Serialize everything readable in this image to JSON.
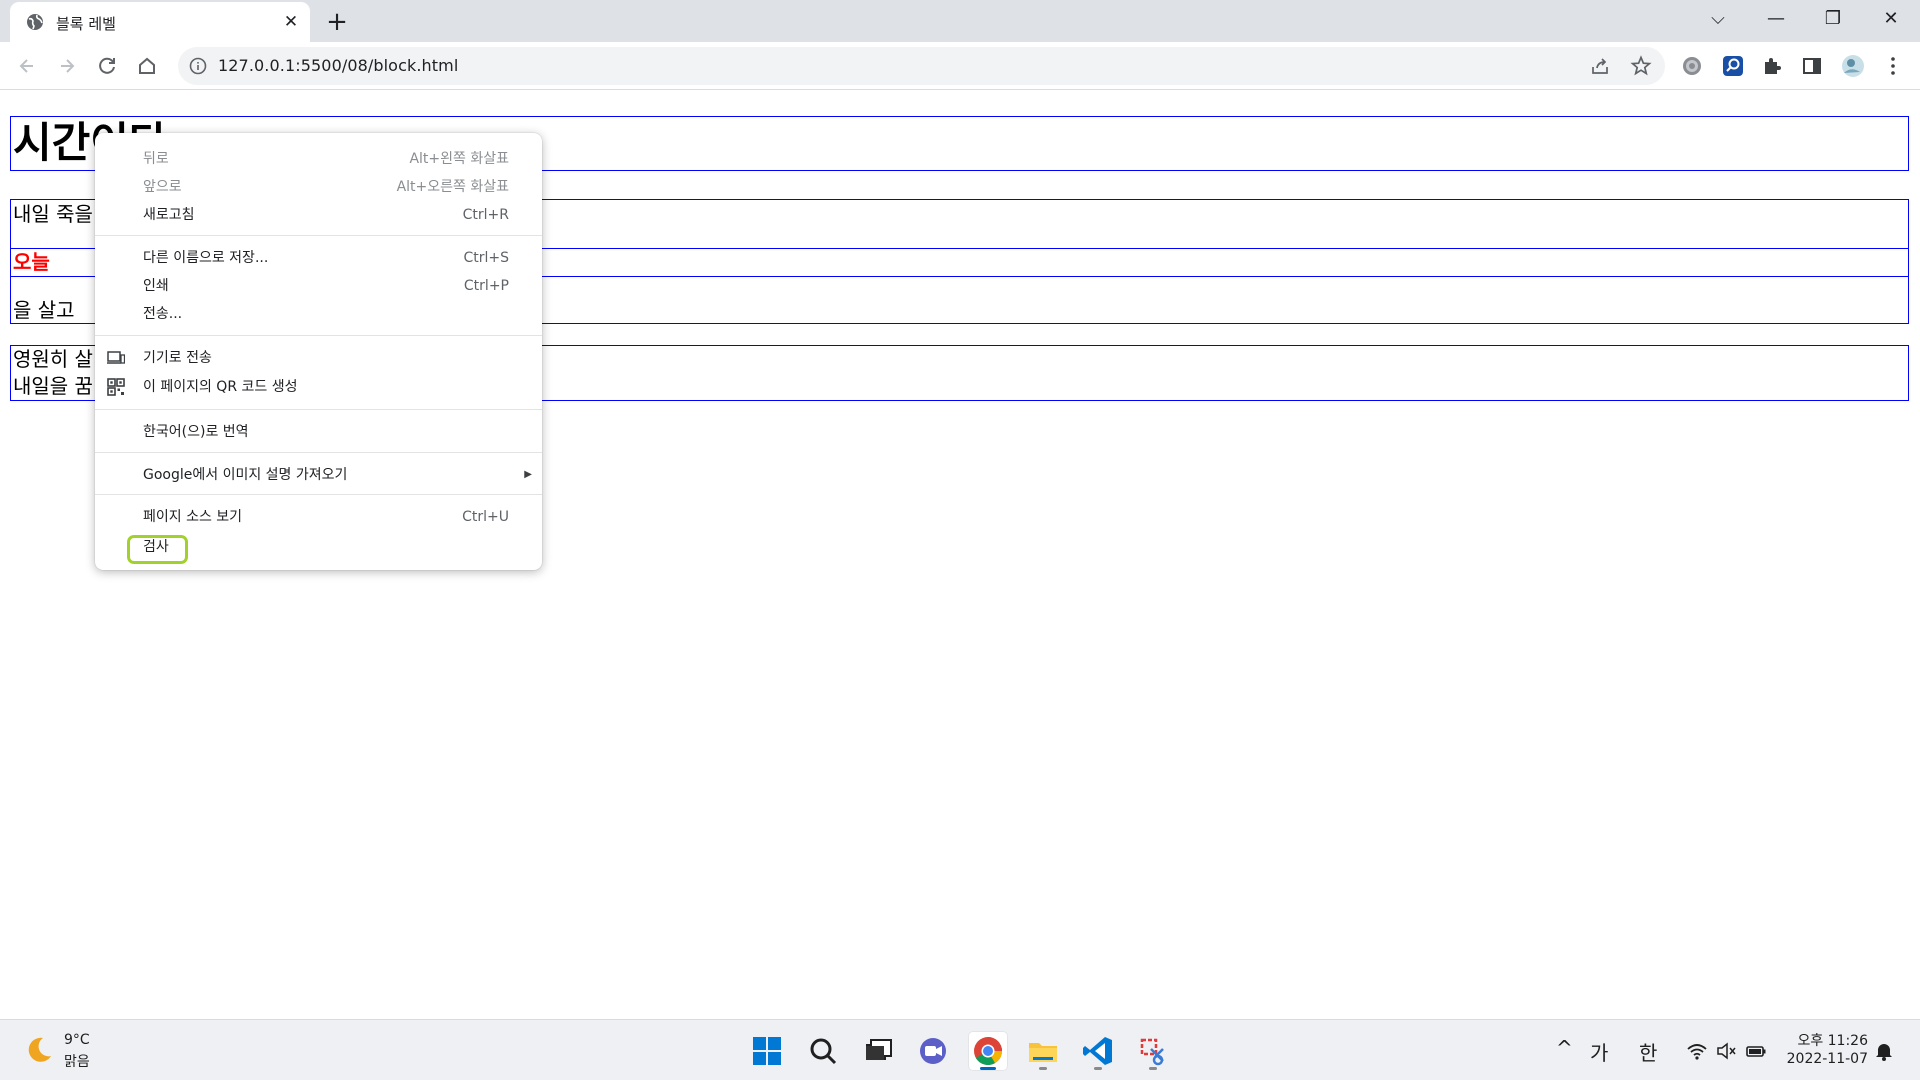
{
  "browser": {
    "tab": {
      "title": "블록 레벨",
      "close_glyph": "✕"
    },
    "new_tab_glyph": "+",
    "window_controls": {
      "tab_search": "⌵",
      "minimize": "—",
      "restore": "❐",
      "close": "✕"
    },
    "url": "127.0.0.1:5500/08/block.html"
  },
  "page": {
    "heading": "시간이다",
    "para1_line1": "내일 죽을",
    "para1_inline_block": "오늘",
    "para1_line3": "을 살고",
    "para2_line1": "영원히 살",
    "para2_line2": "내일을 꿈"
  },
  "context_menu": {
    "back": {
      "label": "뒤로",
      "shortcut": "Alt+왼쪽 화살표"
    },
    "forward": {
      "label": "앞으로",
      "shortcut": "Alt+오른쪽 화살표"
    },
    "reload": {
      "label": "새로고침",
      "shortcut": "Ctrl+R"
    },
    "save_as": {
      "label": "다른 이름으로 저장...",
      "shortcut": "Ctrl+S"
    },
    "print": {
      "label": "인쇄",
      "shortcut": "Ctrl+P"
    },
    "cast": {
      "label": "전송..."
    },
    "send_to_devices": {
      "label": "기기로 전송"
    },
    "qr_code": {
      "label": "이 페이지의 QR 코드 생성"
    },
    "translate": {
      "label": "한국어(으)로 번역"
    },
    "image_descriptions": {
      "label": "Google에서 이미지 설명 가져오기",
      "arrow": "▶"
    },
    "view_source": {
      "label": "페이지 소스 보기",
      "shortcut": "Ctrl+U"
    },
    "inspect": {
      "label": "검사"
    }
  },
  "taskbar": {
    "weather": {
      "temp": "9°C",
      "condition": "맑음"
    },
    "tray": {
      "chevron": "^",
      "ime_mode": "가",
      "language": "한"
    },
    "clock": {
      "time": "오후 11:26",
      "date": "2022-11-07"
    }
  },
  "colors": {
    "block_border": "#0000ff",
    "inline_text": "#ff0000",
    "highlight_ring": "#a2d12c",
    "accent": "#0067c0"
  }
}
